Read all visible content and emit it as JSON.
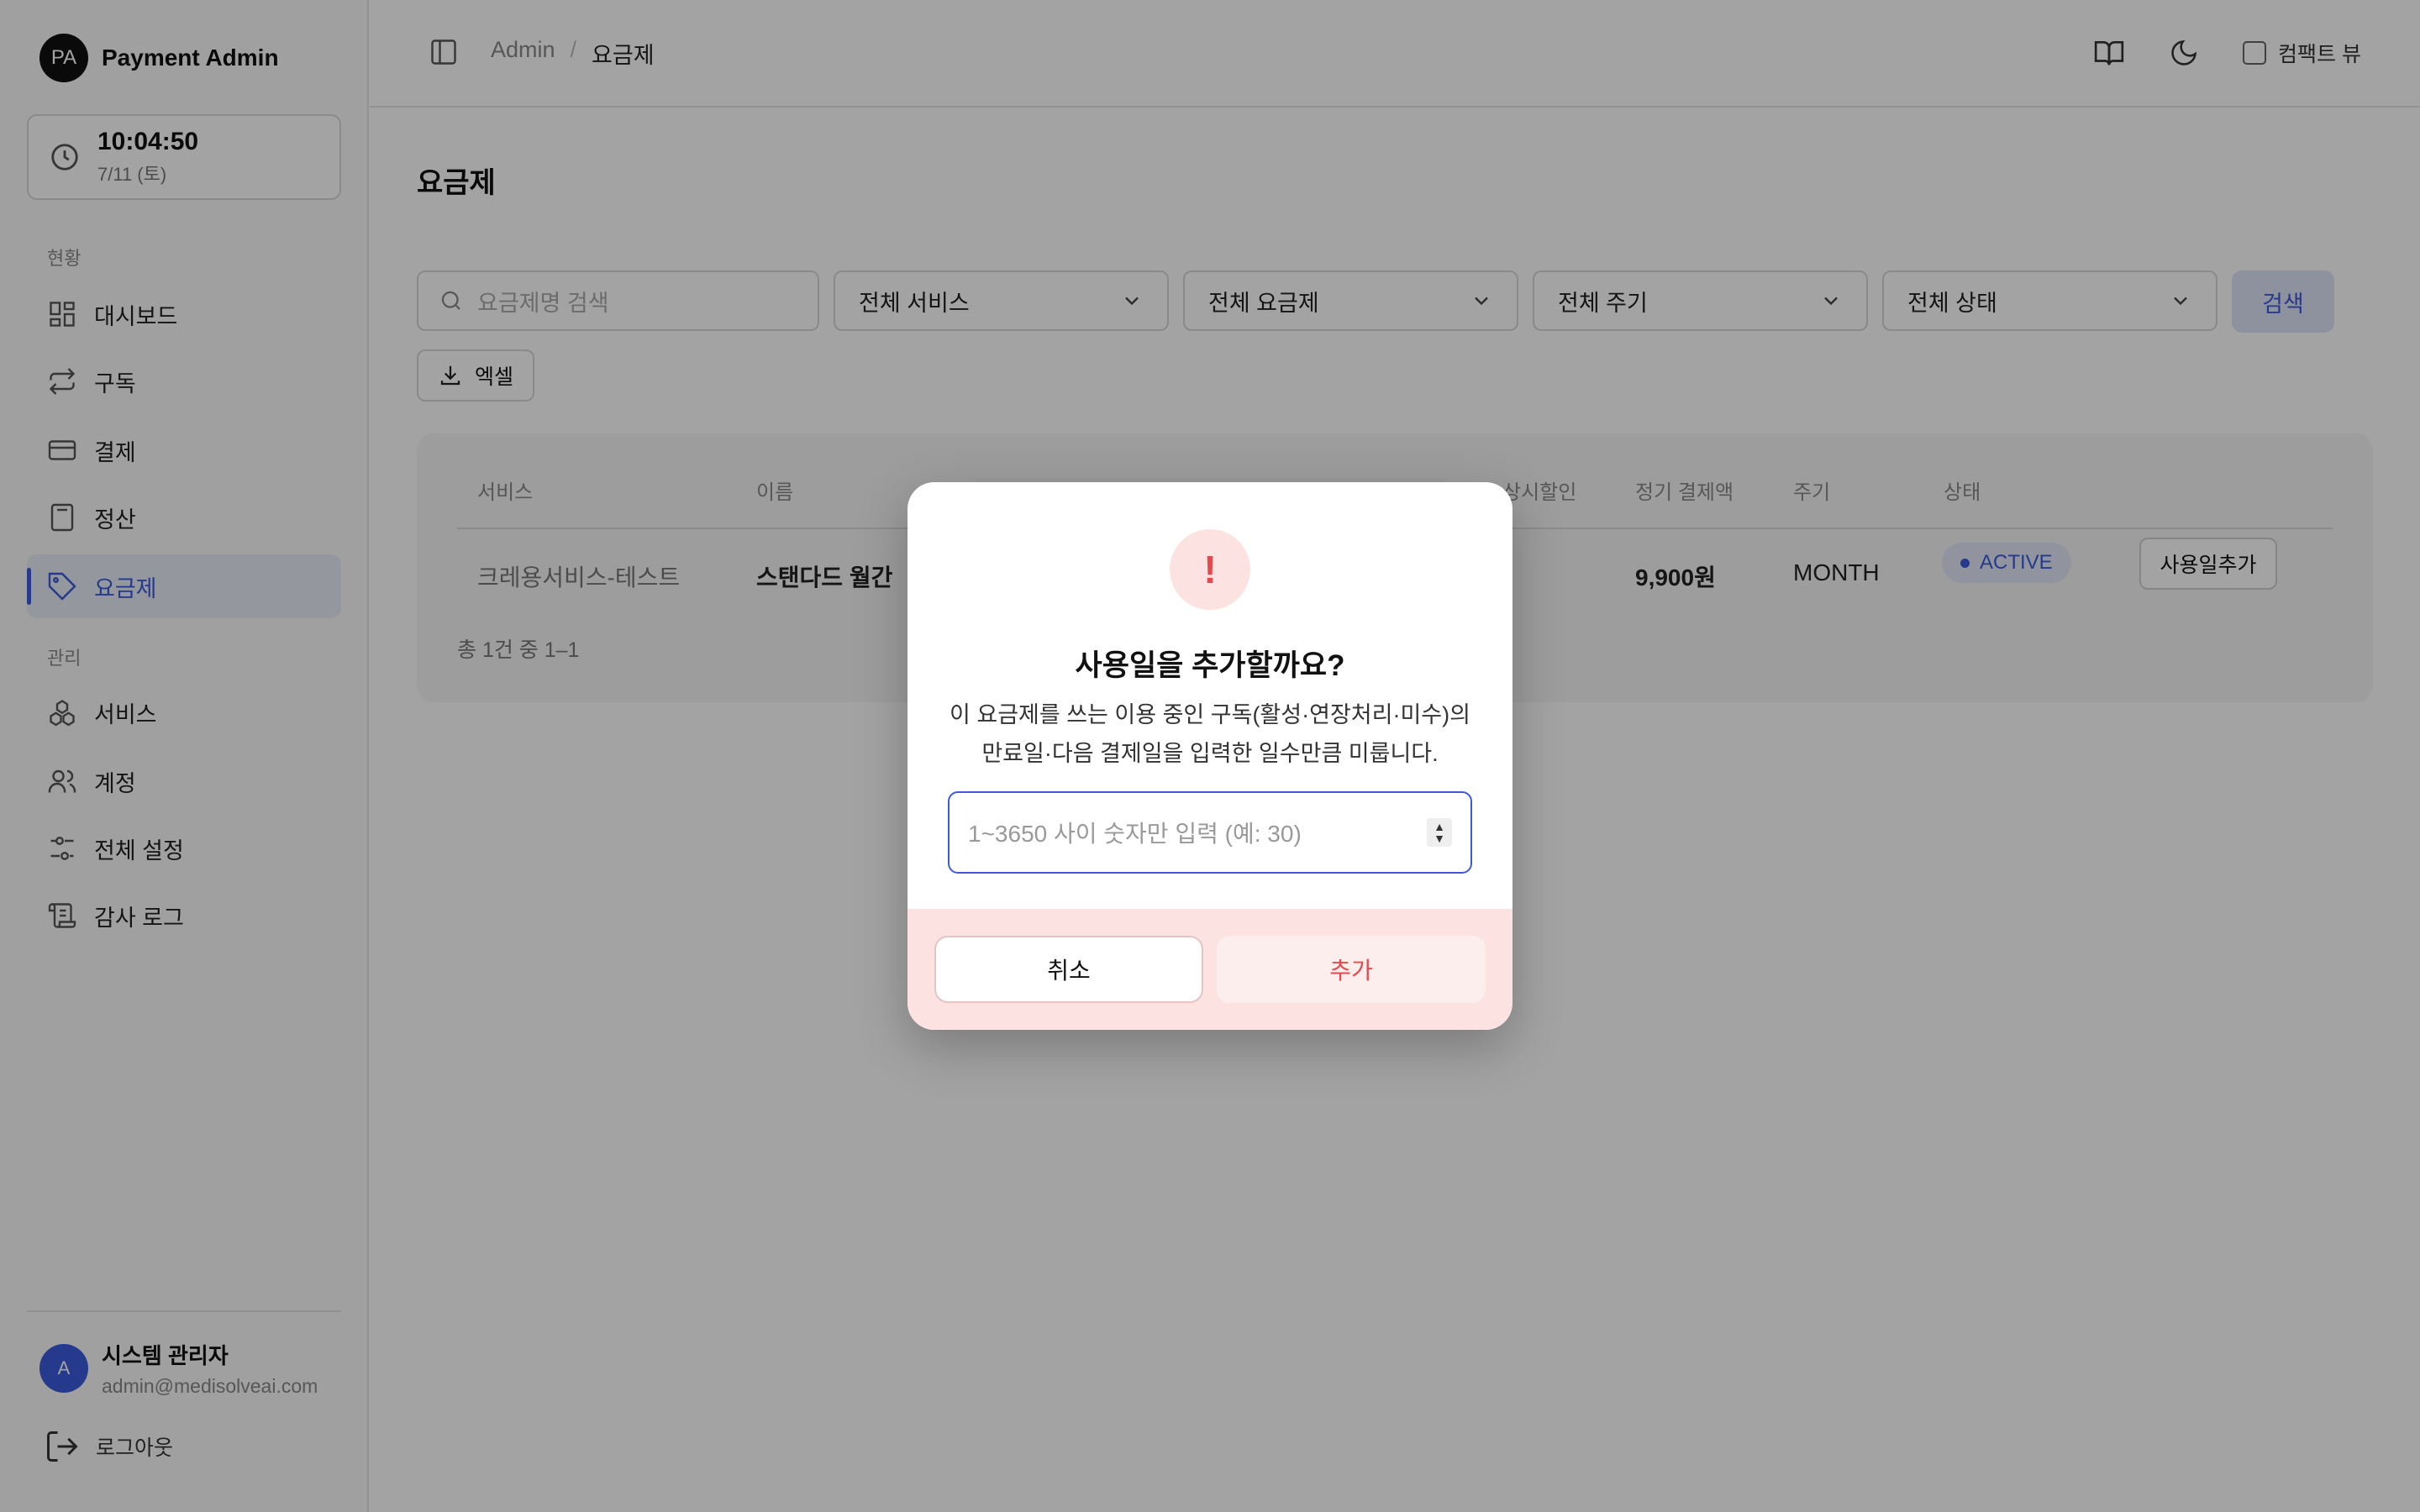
{
  "sidebar": {
    "brand_initials": "PA",
    "brand_name": "Payment Admin",
    "clock_time": "10:04:50",
    "clock_date": "7/11 (토)",
    "section_status": "현황",
    "section_manage": "관리",
    "items": [
      {
        "label": "대시보드",
        "icon": "dashboard-icon"
      },
      {
        "label": "구독",
        "icon": "repeat-icon"
      },
      {
        "label": "결제",
        "icon": "credit-card-icon"
      },
      {
        "label": "정산",
        "icon": "calculator-icon"
      },
      {
        "label": "요금제",
        "icon": "tag-icon"
      },
      {
        "label": "서비스",
        "icon": "boxes-icon"
      },
      {
        "label": "계정",
        "icon": "users-icon"
      },
      {
        "label": "전체 설정",
        "icon": "sliders-icon"
      },
      {
        "label": "감사 로그",
        "icon": "scroll-icon"
      }
    ],
    "active_item": "요금제",
    "user_initial": "A",
    "user_name": "시스템 관리자",
    "user_email": "admin@medisolveai.com",
    "logout_label": "로그아웃"
  },
  "header": {
    "breadcrumb_root": "Admin",
    "breadcrumb_sep": "/",
    "breadcrumb_current": "요금제",
    "compact_view_label": "컴팩트 뷰",
    "compact_view_checked": false
  },
  "main": {
    "title": "요금제",
    "search_placeholder": "요금제명 검색",
    "filters": [
      "전체 서비스",
      "전체 요금제",
      "전체 주기",
      "전체 상태"
    ],
    "search_button": "검색",
    "excel_button": "엑셀",
    "table": {
      "headers": [
        "서비스",
        "이름",
        "상시할인",
        "정기 결제액",
        "주기",
        "상태"
      ],
      "row": {
        "service": "크레용서비스-테스트",
        "name": "스탠다드 월간",
        "discount": "-",
        "price": "9,900원",
        "cycle": "MONTH",
        "status": "ACTIVE",
        "action": "사용일추가"
      },
      "summary": "총 1건 중 1–1"
    }
  },
  "dialog": {
    "icon_glyph": "!",
    "title": "사용일을 추가할까요?",
    "desc_line1": "이 요금제를 쓰는 이용 중인 구독(활성·연장처리·미수)의",
    "desc_line2": "만료일·다음 결제일을 입력한 일수만큼 미룹니다.",
    "input_placeholder": "1~3650 사이 숫자만 입력 (예: 30)",
    "cancel_label": "취소",
    "confirm_label": "추가"
  },
  "colors": {
    "accent": "#3b5bdb",
    "danger": "#e5484d",
    "danger_bg": "#fde2e2"
  }
}
